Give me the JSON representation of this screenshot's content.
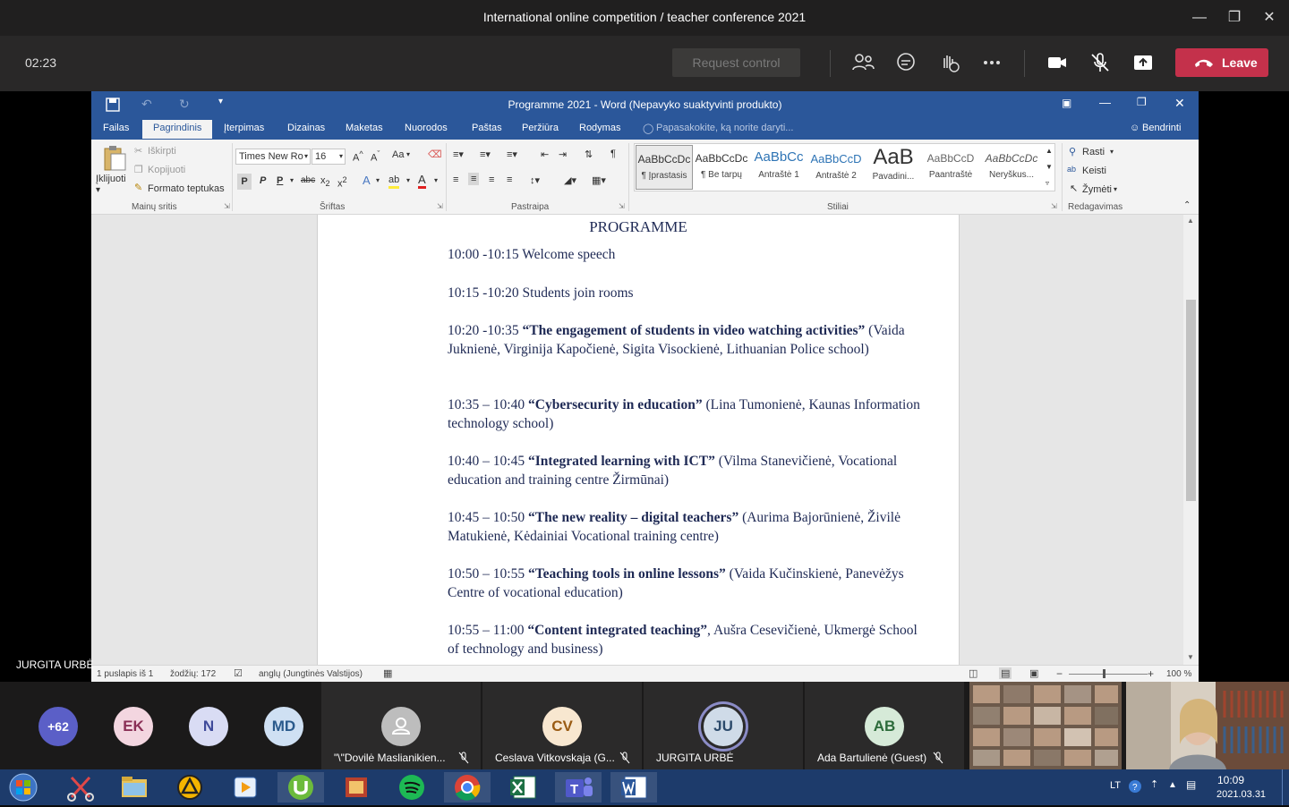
{
  "teams": {
    "window_title": "International online competition / teacher conference 2021",
    "timer": "02:23",
    "request_control": "Request control",
    "leave": "Leave",
    "presenter_name": "JURGITA URBĖ"
  },
  "word": {
    "title": "Programme 2021 - Word (Nepavyko suaktyvinti produkto)",
    "tabs": [
      "Failas",
      "Pagrindinis",
      "Įterpimas",
      "Dizainas",
      "Maketas",
      "Nuorodos",
      "Paštas",
      "Peržiūra",
      "Rodymas"
    ],
    "tell_me": "Papasakokite, ką norite daryti...",
    "share": "Bendrinti",
    "clipboard": {
      "paste": "Įklijuoti",
      "cut": "Iškirpti",
      "copy": "Kopijuoti",
      "format_painter": "Formato teptukas",
      "group": "Mainų sritis"
    },
    "font": {
      "name": "Times New Ro",
      "size": "16",
      "group": "Šriftas",
      "bold": "P",
      "italic": "P",
      "underline": "P",
      "strike": "abc",
      "case": "Aa"
    },
    "paragraph_group": "Pastraipa",
    "styles": {
      "group": "Stiliai",
      "items": [
        {
          "sample": "AaBbCcDc",
          "name": "¶ Įprastasis"
        },
        {
          "sample": "AaBbCcDc",
          "name": "¶ Be tarpų"
        },
        {
          "sample": "AaBbCc",
          "name": "Antraštė 1"
        },
        {
          "sample": "AaBbCcD",
          "name": "Antraštė 2"
        },
        {
          "sample": "AaB",
          "name": "Pavadini..."
        },
        {
          "sample": "AaBbCcD",
          "name": "Paantraštė"
        },
        {
          "sample": "AaBbCcDc",
          "name": "Neryškus..."
        }
      ]
    },
    "editing": {
      "find": "Rasti",
      "replace": "Keisti",
      "select": "Žymėti",
      "group": "Redagavimas"
    },
    "status": {
      "page": "1 puslapis iš 1",
      "words": "žodžių: 172",
      "language": "anglų (Jungtinės Valstijos)",
      "zoom": "100 %"
    }
  },
  "document": {
    "heading": "PROGRAMME",
    "entries": [
      {
        "time": "10:00 -10:15 Welcome speech",
        "title": "",
        "rest": ""
      },
      {
        "time": "10:15 -10:20 Students join rooms",
        "title": "",
        "rest": ""
      },
      {
        "time": "10:20 -10:35 ",
        "title": "“The engagement of students in video watching activities”",
        "rest": " (Vaida Juknienė, Virginija Kapočienė, Sigita Visockienė, Lithuanian Police school)"
      },
      {
        "time": "10:35 – 10:40 ",
        "title": "“Cybersecurity in education”",
        "rest": " (Lina Tumonienė, Kaunas Information technology school)"
      },
      {
        "time": "10:40 – 10:45 ",
        "title": "“Integrated learning with ICT”",
        "rest": " (Vilma Stanevičienė, Vocational education and training centre Žirmūnai)"
      },
      {
        "time": "10:45 – 10:50 ",
        "title": "“The new reality – digital teachers”",
        "rest": " (Aurima Bajorūnienė, Živilė Matukienė, Kėdainiai Vocational training centre)"
      },
      {
        "time": "10:50 – 10:55 ",
        "title": "“Teaching tools in online lessons”",
        "rest": " (Vaida Kučinskienė, Panevėžys Centre of vocational education)"
      },
      {
        "time": "10:55 – 11:00 ",
        "title": "“Content integrated teaching”",
        "rest": ", Aušra Cesevičienė, Ukmergė School of technology and business)"
      }
    ]
  },
  "participants": {
    "overflow": "+62",
    "small": [
      {
        "initials": "EK",
        "bg": "#f3d6e0",
        "fg": "#8a2f56"
      },
      {
        "initials": "N",
        "bg": "#d9dcf4",
        "fg": "#3f4a9a"
      },
      {
        "initials": "MD",
        "bg": "#cfe0f3",
        "fg": "#2a5a8c"
      }
    ],
    "tiles": [
      {
        "initials": "",
        "name": "\"\\\"Dovilė Maslianikien...",
        "bg": "#bdbdbd",
        "fg": "#fff"
      },
      {
        "initials": "CV",
        "name": "Ceslava Vitkovskaja (G...",
        "bg": "#f8e7d0",
        "fg": "#9a5b13"
      },
      {
        "initials": "JU",
        "name": "JURGITA URBĖ",
        "bg": "#cfdbe8",
        "fg": "#2c4a6b"
      },
      {
        "initials": "AB",
        "name": "Ada Bartulienė (Guest)",
        "bg": "#d6ead8",
        "fg": "#2c6b3a"
      }
    ]
  },
  "taskbar": {
    "lang": "LT",
    "time": "10:09",
    "date": "2021.03.31"
  }
}
